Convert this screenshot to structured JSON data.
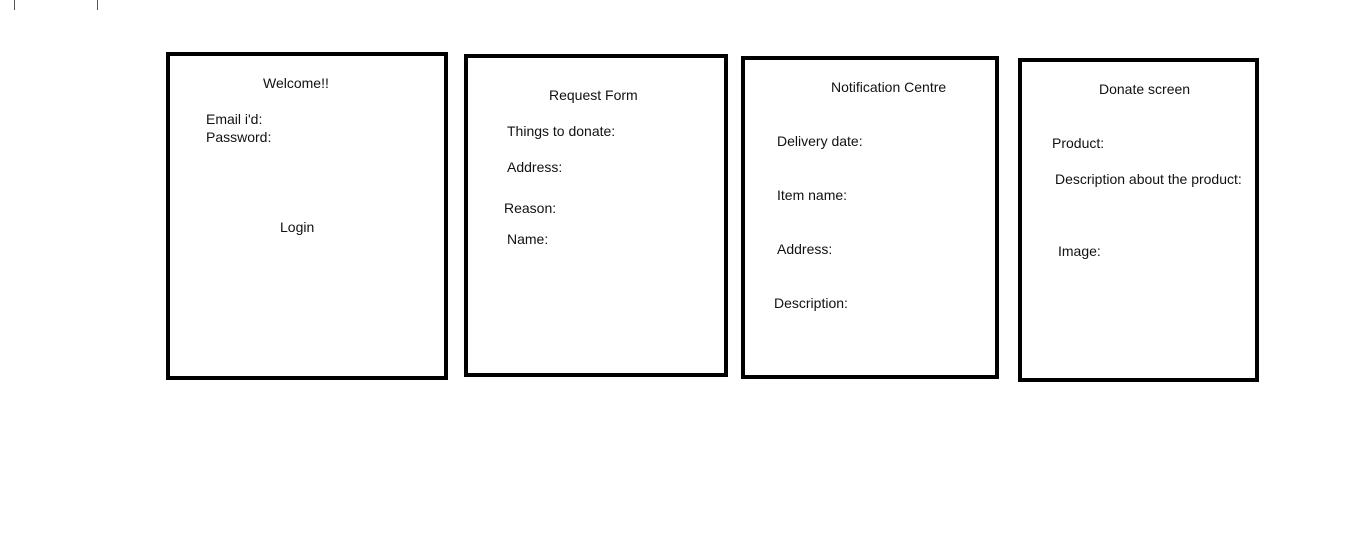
{
  "login_screen": {
    "title": "Welcome!!",
    "email_label": "Email i'd:",
    "password_label": "Password:",
    "login_label": "Login"
  },
  "request_form": {
    "title": "Request Form",
    "fields": [
      "Things to donate:",
      "Address:",
      "Reason:",
      "Name:"
    ]
  },
  "notification_centre": {
    "title": "Notification Centre",
    "fields": [
      "Delivery date:",
      "Item name:",
      "Address:",
      "Description:"
    ]
  },
  "donate_screen": {
    "title": "Donate screen",
    "fields": [
      "Product:",
      "Description about the product:",
      "Image:"
    ]
  }
}
